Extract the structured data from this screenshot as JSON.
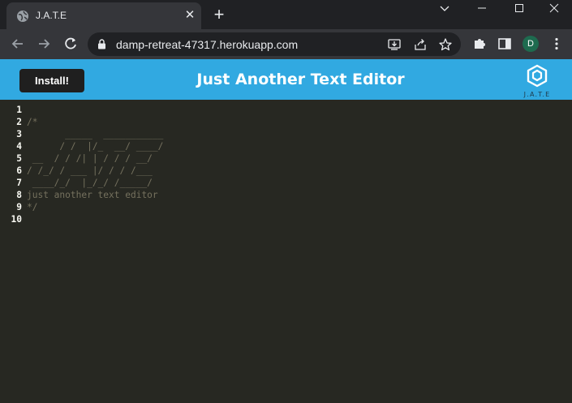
{
  "browser": {
    "tab_title": "J.A.T.E",
    "tab_close": "✕",
    "new_tab": "+",
    "url": "damp-retreat-47317.herokuapp.com",
    "profile_initial": "D"
  },
  "app": {
    "install_label": "Install!",
    "title": "Just Another Text Editor",
    "logo_text": "J.A.T.E"
  },
  "editor": {
    "line_numbers": [
      "1",
      "2",
      "3",
      "4",
      "5",
      "6",
      "7",
      "8",
      "9",
      "10"
    ],
    "lines": [
      "",
      "/*",
      "       _____  ___________",
      "      / /  |/_  __/ ____/",
      " __  / / /| | / / / __/",
      "/ /_/ / ___ |/ / / /___",
      " ____/_/  |_/_/ /_____/",
      "just another text editor",
      "*/",
      ""
    ]
  },
  "colors": {
    "header": "#31a9e1",
    "editor_bg": "#272822",
    "comment": "#75715e",
    "line_number": "#f8f8f2"
  }
}
